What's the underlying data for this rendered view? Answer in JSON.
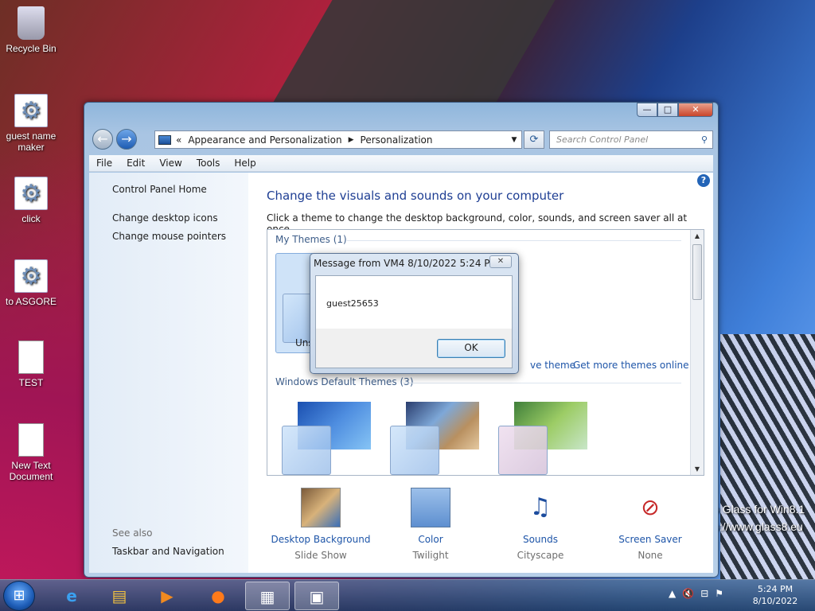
{
  "desktop": {
    "icons": [
      {
        "label": "Recycle Bin",
        "icon": "recycle-bin-icon"
      },
      {
        "label": "guest name maker",
        "icon": "gear-icon"
      },
      {
        "label": "click",
        "icon": "gear-icon"
      },
      {
        "label": "to ASGORE",
        "icon": "gear-icon"
      },
      {
        "label": "TEST",
        "icon": "document-icon"
      },
      {
        "label": "New Text Document",
        "icon": "document-icon"
      }
    ],
    "watermark": {
      "line1": "o Glass for Win8.1",
      "line2": "o://www.glass8.eu"
    }
  },
  "window": {
    "caption_buttons": {
      "minimize": "—",
      "maximize": "□",
      "close": "✕"
    },
    "address": {
      "prefix": "«",
      "crumb1": "Appearance and Personalization",
      "crumb2": "Personalization"
    },
    "search_placeholder": "Search Control Panel",
    "menu": [
      "File",
      "Edit",
      "View",
      "Tools",
      "Help"
    ],
    "left_pane": {
      "home": "Control Panel Home",
      "links": [
        "Change desktop icons",
        "Change mouse pointers"
      ],
      "see_also": "See also",
      "see_also_links": [
        "Taskbar and Navigation"
      ]
    },
    "heading": "Change the visuals and sounds on your computer",
    "subheading": "Click a theme to change the desktop background, color, sounds, and screen saver all at once.",
    "themes": {
      "my_themes": "My Themes (1)",
      "unsaved_label": "Uns",
      "save_theme": "ve theme",
      "get_more": "Get more themes online",
      "default_themes": "Windows Default Themes (3)"
    },
    "bottom": [
      {
        "label": "Desktop Background",
        "value": "Slide Show",
        "icon": "desktop-background-icon"
      },
      {
        "label": "Color",
        "value": "Twilight",
        "icon": "color-icon"
      },
      {
        "label": "Sounds",
        "value": "Cityscape",
        "icon": "sounds-icon"
      },
      {
        "label": "Screen Saver",
        "value": "None",
        "icon": "screen-saver-icon"
      }
    ]
  },
  "dialog": {
    "title": "Message from VM4 8/10/2022 5:24 PM",
    "message": "guest25653",
    "ok": "OK"
  },
  "taskbar": {
    "clock_time": "5:24 PM",
    "clock_date": "8/10/2022"
  }
}
